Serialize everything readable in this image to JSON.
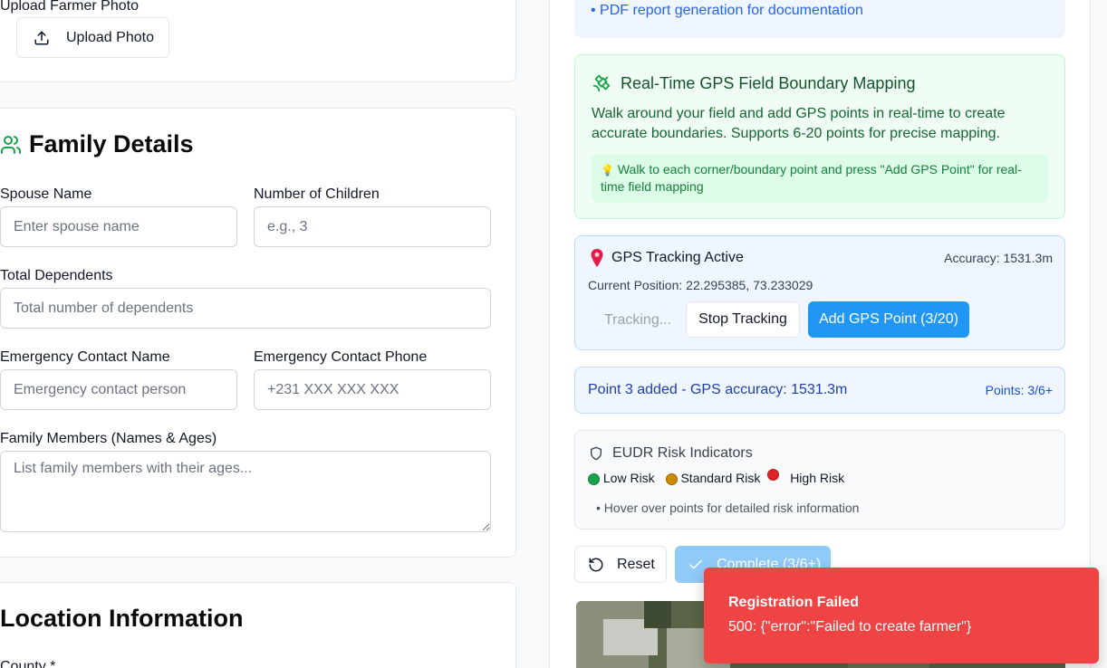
{
  "upload": {
    "label": "Upload Farmer Photo",
    "button": "Upload Photo"
  },
  "family": {
    "title": "Family Details",
    "spouse_label": "Spouse Name",
    "spouse_placeholder": "Enter spouse name",
    "children_label": "Number of Children",
    "children_placeholder": "e.g., 3",
    "dependents_label": "Total Dependents",
    "dependents_placeholder": "Total number of dependents",
    "emergency_name_label": "Emergency Contact Name",
    "emergency_name_placeholder": "Emergency contact person",
    "emergency_phone_label": "Emergency Contact Phone",
    "emergency_phone_placeholder": "+231 XXX XXX XXX",
    "members_label": "Family Members (Names & Ages)",
    "members_placeholder": "List family members with their ages..."
  },
  "location": {
    "title": "Location Information",
    "county_label": "County *"
  },
  "gps": {
    "feature_bullet": "• PDF report generation for documentation",
    "mapping_title": "Real-Time GPS Field Boundary Mapping",
    "mapping_desc": "Walk around your field and add GPS points in real-time to create accurate boundaries. Supports 6-20 points for precise mapping.",
    "mapping_tip": "Walk to each corner/boundary point and press \"Add GPS Point\" for real-time field mapping",
    "tracking_title": "GPS Tracking Active",
    "accuracy": "Accuracy: 1531.3m",
    "position": "Current Position: 22.295385, 73.233029",
    "tracking_status": "Tracking...",
    "stop_button": "Stop Tracking",
    "add_button": "Add GPS Point (3/20)",
    "point_added": "Point 3 added - GPS accuracy: 1531.3m",
    "points_count": "Points: 3/6+",
    "risk_title": "EUDR Risk Indicators",
    "risk_low": "Low Risk",
    "risk_standard": "Standard Risk",
    "risk_high": "High Risk",
    "risk_hint": "• Hover over points for detailed risk information",
    "reset_button": "Reset",
    "complete_button": "Complete (3/6+)"
  },
  "toast": {
    "title": "Registration Failed",
    "message": "500: {\"error\":\"Failed to create farmer\"}"
  },
  "colors": {
    "accent_blue": "#2196f3",
    "success_green": "#16a34a",
    "error_red": "#ef4444",
    "risk_low": "#16a34a",
    "risk_standard": "#ca8a04",
    "risk_high": "#dc2626"
  },
  "icons": {
    "upload": "upload-icon",
    "family": "users-icon",
    "satellite": "satellite-icon",
    "pin": "map-pin-icon",
    "shield": "shield-icon",
    "reset": "rotate-ccw-icon",
    "check": "check-icon",
    "bulb": "lightbulb-icon"
  }
}
